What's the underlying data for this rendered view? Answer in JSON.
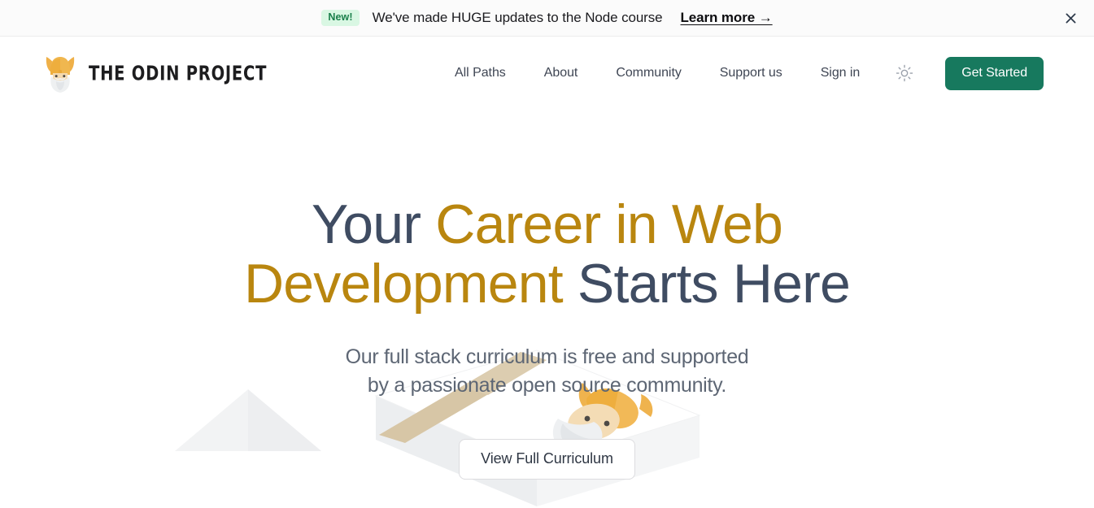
{
  "announcement": {
    "badge": "New!",
    "message": "We've made HUGE updates to the Node course",
    "link_label": "Learn more →",
    "close_icon": "close-icon",
    "badge_bg": "#d9f7e3",
    "badge_fg": "#1a7f4b",
    "bar_bg": "#fbfbfb"
  },
  "header": {
    "brand_name": "THE ODIN PROJECT",
    "brand_icon": "odin-viking-logo-icon",
    "nav": [
      {
        "label": "All Paths",
        "name": "nav-all-paths"
      },
      {
        "label": "About",
        "name": "nav-about"
      },
      {
        "label": "Community",
        "name": "nav-community"
      },
      {
        "label": "Support us",
        "name": "nav-support-us"
      },
      {
        "label": "Sign in",
        "name": "nav-sign-in"
      }
    ],
    "theme_toggle_icon": "sun-icon",
    "cta_label": "Get Started",
    "cta_color": "#17795e"
  },
  "hero": {
    "title_part1": "Your ",
    "title_accent": "Career in Web Development",
    "title_part2": " Starts Here",
    "subtitle": "Our full stack curriculum is free and supported by a passionate open source community.",
    "curriculum_button": "View Full Curriculum",
    "accent_color": "#b9860f",
    "heading_color": "#3f4c62",
    "illustration": "isometric-desk-with-viking-mascot"
  }
}
